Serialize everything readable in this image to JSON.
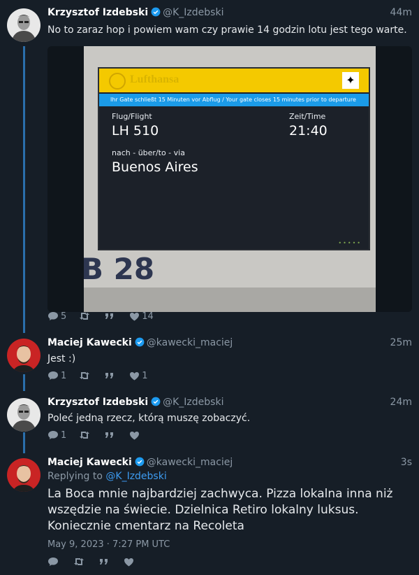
{
  "tweets": [
    {
      "name": "Krzysztof Izdebski",
      "handle": "@K_Izdebski",
      "time": "44m",
      "text": "No to zaraz hop i powiem wam czy prawie 14 godzin lotu jest tego warte.",
      "stats": {
        "replies": "5",
        "quotes_label": "",
        "likes": "14"
      },
      "photo": {
        "brand": "Lufthansa",
        "banner": "Ihr Gate schließt 15 Minuten vor Abflug / Your gate closes 15 minutes prior to departure",
        "flight_label": "Flug/Flight",
        "flight": "LH 510",
        "time_label": "Zeit/Time",
        "time": "21:40",
        "via_label": "nach - über/to - via",
        "destination": "Buenos Aires",
        "gate": "B 28"
      }
    },
    {
      "name": "Maciej Kawecki",
      "handle": "@kawecki_maciej",
      "time": "25m",
      "text": "Jest :)",
      "stats": {
        "replies": "1",
        "likes": "1"
      }
    },
    {
      "name": "Krzysztof Izdebski",
      "handle": "@K_Izdebski",
      "time": "24m",
      "text": "Poleć jedną rzecz, którą muszę zobaczyć.",
      "stats": {
        "replies": "1",
        "likes": ""
      }
    },
    {
      "name": "Maciej Kawecki",
      "handle": "@kawecki_maciej",
      "time": "3s",
      "replying_prefix": "Replying to",
      "replying_to": "@K_Izdebski",
      "text": "La Boca mnie najbardziej zachwyca. Pizza lokalna inna niż wszędzie na świecie. Dzielnica Retiro lokalny luksus. Koniecznie cmentarz na Recoleta",
      "date": "May 9, 2023 · 7:27 PM UTC",
      "stats": {
        "replies": "",
        "likes": ""
      }
    }
  ],
  "icons": {
    "reply": "comment-icon",
    "retweet": "retweet-icon",
    "quote": "quote-icon",
    "like": "heart-icon",
    "verified": "verified-badge-icon"
  },
  "colors": {
    "background": "#161e27",
    "thread_line": "#2a6fab",
    "link": "#3d9bf0",
    "verified": "#1d9bf0",
    "muted": "#8b98a5"
  }
}
